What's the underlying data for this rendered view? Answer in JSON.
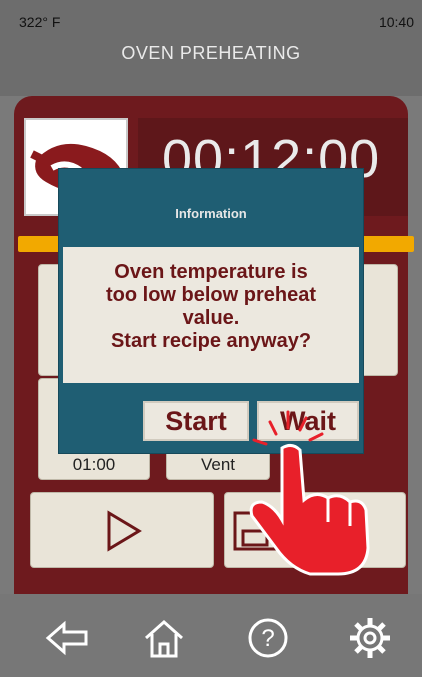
{
  "status": {
    "temperature": "322° F",
    "time": "10:40"
  },
  "header": {
    "title": "OVEN PREHEATING"
  },
  "timer": {
    "value": "00:12:00"
  },
  "progress": {
    "fraction": 1.0,
    "color": "#f2a900"
  },
  "tiles": {
    "hold_time": "01:00",
    "vent": "Vent"
  },
  "dialog": {
    "title": "Information",
    "message_lines": [
      "Oven temperature is",
      "too low below preheat",
      "value.",
      "Start recipe anyway?"
    ],
    "start_label": "Start",
    "wait_label": "Wait"
  },
  "nav": {
    "icons": [
      "back-arrow-icon",
      "home-icon",
      "help-icon",
      "settings-gear-icon"
    ]
  },
  "colors": {
    "panel": "#6e1a1e",
    "dialog": "#1f5e73",
    "accent": "#f2a900",
    "hand": "#e8202a"
  }
}
